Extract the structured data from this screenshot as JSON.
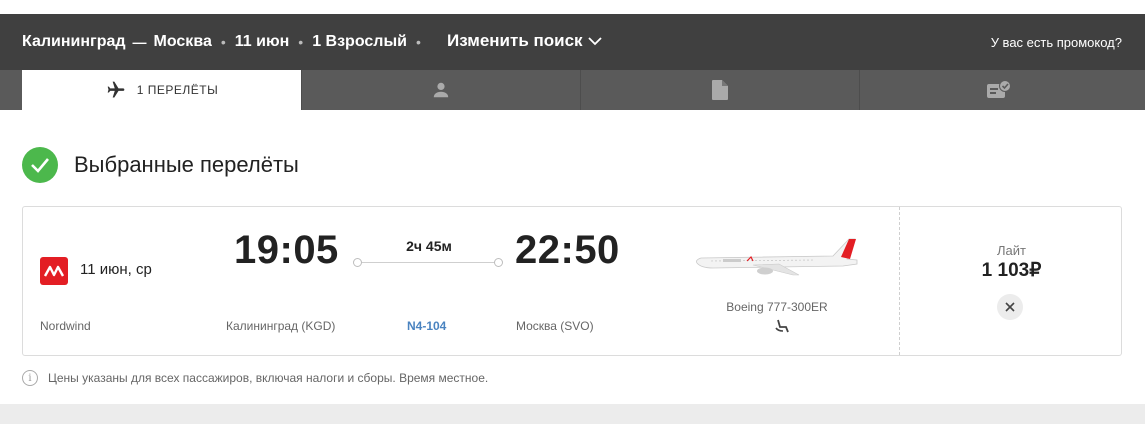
{
  "header": {
    "origin": "Калининград",
    "dash": "—",
    "destination": "Москва",
    "date": "11 июн",
    "passengers": "1 Взрослый",
    "change_search": "Изменить поиск",
    "promo": "У вас есть промокод?"
  },
  "tabs": [
    {
      "label": "1 ПЕРЕЛЁТЫ",
      "icon": "plane-icon",
      "active": true
    },
    {
      "label": "",
      "icon": "person-icon",
      "active": false
    },
    {
      "label": "",
      "icon": "document-icon",
      "active": false
    },
    {
      "label": "",
      "icon": "checkin-icon",
      "active": false
    }
  ],
  "section": {
    "title": "Выбранные перелёты"
  },
  "flight": {
    "date": "11 июн, ср",
    "airline": "Nordwind",
    "departure_time": "19:05",
    "arrival_time": "22:50",
    "duration": "2ч 45м",
    "from_city": "Калининград (KGD)",
    "flight_number": "N4-104",
    "to_city": "Москва (SVO)",
    "aircraft": "Boeing 777-300ER",
    "fare_name": "Лайт",
    "price": "1 103₽"
  },
  "note": "Цены указаны для всех пассажиров, включая налоги и сборы. Время местное.",
  "colors": {
    "header_bg": "#404040",
    "tabs_bg": "#5a5a5a",
    "check_green": "#4cb84c",
    "brand_red": "#e31e24",
    "link_blue": "#4a83c0"
  }
}
